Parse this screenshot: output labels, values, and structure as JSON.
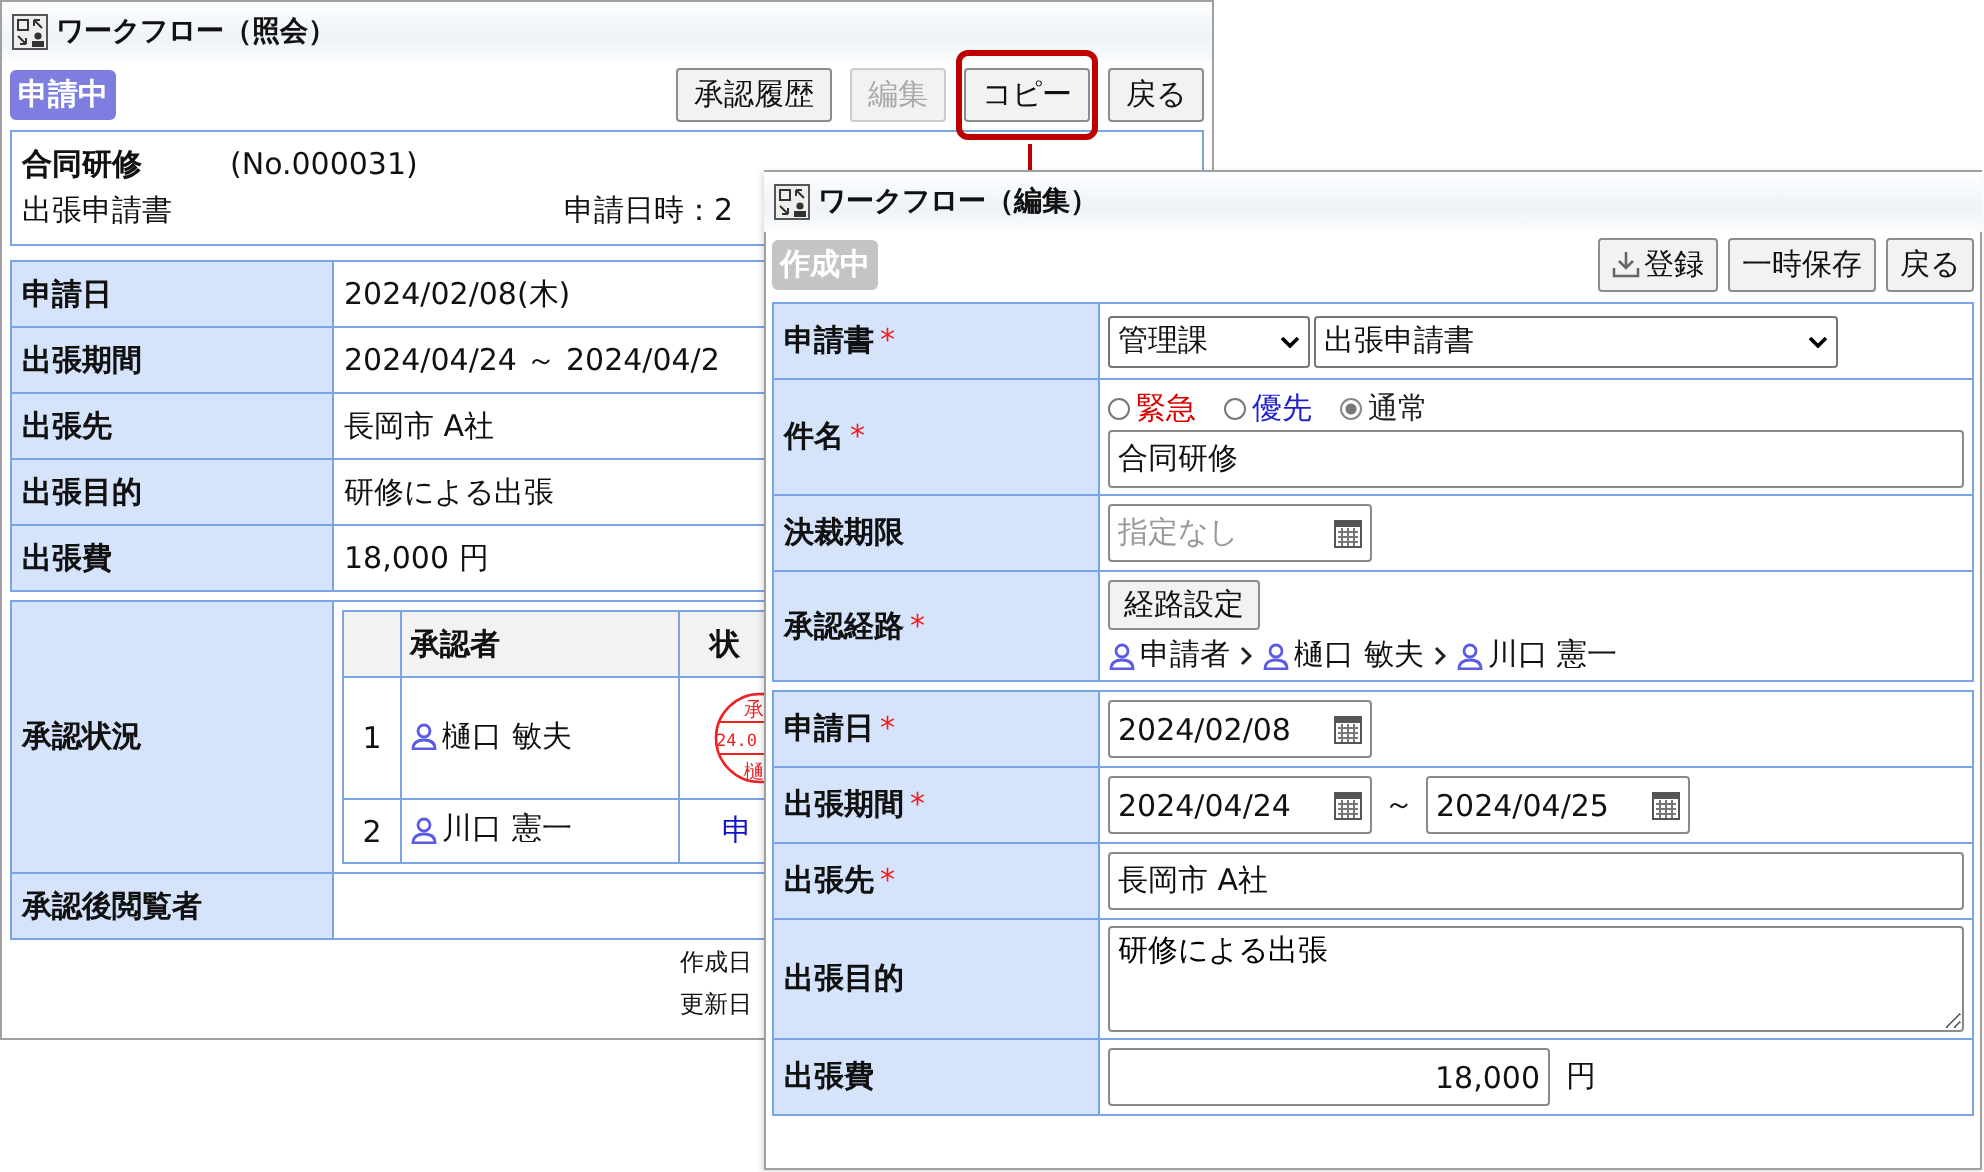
{
  "back_window": {
    "title": "ワークフロー（照会）",
    "badge": {
      "label": "申請中",
      "kind": "pending"
    },
    "buttons": [
      {
        "label": "承認履歴",
        "disabled": false,
        "highlighted": false
      },
      {
        "label": "編集",
        "disabled": true,
        "highlighted": false
      },
      {
        "label": "コピー",
        "disabled": false,
        "highlighted": true
      },
      {
        "label": "戻る",
        "disabled": false,
        "highlighted": false
      }
    ],
    "summary": {
      "subject": "合同研修",
      "number": "(No.000031)",
      "form": "出張申請書",
      "date_label": "申請日時：2"
    },
    "fields": [
      {
        "label": "申請日",
        "value": "2024/02/08(木)"
      },
      {
        "label": "出張期間",
        "value": "2024/04/24 ～ 2024/04/2"
      },
      {
        "label": "出張先",
        "value": "長岡市 A社"
      },
      {
        "label": "出張目的",
        "value": "研修による出張"
      },
      {
        "label": "出張費",
        "value": "18,000 円"
      }
    ],
    "approval": {
      "label": "承認状況",
      "columns": [
        "承認者",
        "状"
      ],
      "rows": [
        {
          "no": "1",
          "approver": "樋口 敏夫",
          "kind": "stamp",
          "stamp_lines": [
            "承",
            "24.0",
            "樋"
          ]
        },
        {
          "no": "2",
          "approver": "川口 憲一",
          "kind": "text",
          "status": "申"
        }
      ]
    },
    "viewers_label": "承認後閲覧者",
    "footer": [
      "作成日",
      "更新日"
    ]
  },
  "front_window": {
    "title": "ワークフロー（編集）",
    "badge": {
      "label": "作成中",
      "kind": "draft"
    },
    "buttons": [
      {
        "label": "登録",
        "kind": "download"
      },
      {
        "label": "一時保存",
        "kind": "plain"
      },
      {
        "label": "戻る",
        "kind": "plain"
      }
    ],
    "sections": [
      {
        "rows": [
          {
            "label": "申請書",
            "required_mark": "*",
            "kind": "selects",
            "selects": [
              "管理課",
              "出張申請書"
            ]
          },
          {
            "label": "件名",
            "required_mark": "*",
            "kind": "subject",
            "options": [
              {
                "label": "緊急",
                "selected": false,
                "color": "#dd0000"
              },
              {
                "label": "優先",
                "selected": false,
                "color": "#2020cc"
              },
              {
                "label": "通常",
                "selected": true,
                "color": "#222222"
              }
            ],
            "value": "合同研修"
          },
          {
            "label": "決裁期限",
            "kind": "date",
            "placeholder": "指定なし"
          },
          {
            "label": "承認経路",
            "required_mark": "*",
            "kind": "route",
            "button": "経路設定",
            "route": [
              "申請者",
              "樋口 敏夫",
              "川口 憲一"
            ]
          }
        ]
      },
      {
        "rows": [
          {
            "label": "申請日",
            "required_mark": "*",
            "kind": "date",
            "value": "2024/02/08"
          },
          {
            "label": "出張期間",
            "required_mark": "*",
            "kind": "range",
            "from": "2024/04/24",
            "separator": "～",
            "to": "2024/04/25"
          },
          {
            "label": "出張先",
            "required_mark": "*",
            "kind": "text",
            "value": "長岡市 A社"
          },
          {
            "label": "出張目的",
            "kind": "textarea",
            "value": "研修による出張"
          },
          {
            "label": "出張費",
            "kind": "number",
            "value": "18,000",
            "unit": "円"
          }
        ]
      }
    ]
  }
}
